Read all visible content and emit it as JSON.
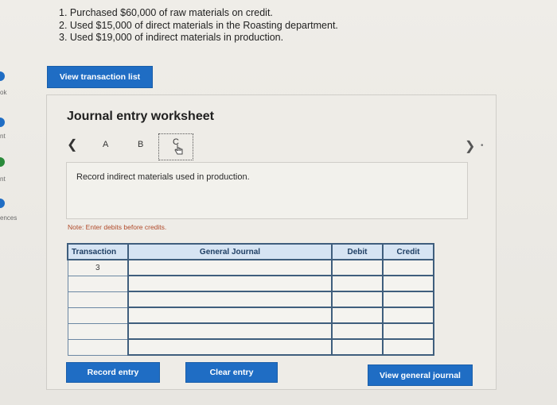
{
  "sidebar": {
    "items": [
      {
        "label": "ok"
      },
      {
        "label": "nt"
      },
      {
        "label": "nt"
      },
      {
        "label": "ences"
      }
    ]
  },
  "instructions": [
    "1. Purchased $60,000 of raw materials on credit.",
    "2. Used $15,000 of direct materials in the Roasting department.",
    "3. Used $19,000 of indirect materials in production."
  ],
  "view_transaction_list": "View transaction list",
  "worksheet": {
    "title": "Journal entry worksheet",
    "tabs": [
      "A",
      "B",
      "C"
    ],
    "description": "Record indirect materials used in production.",
    "note": "Note: Enter debits before credits.",
    "table": {
      "headers": [
        "Transaction",
        "General Journal",
        "Debit",
        "Credit"
      ],
      "transaction_number": "3",
      "row_count": 6
    },
    "buttons": {
      "record": "Record entry",
      "clear": "Clear entry",
      "view_journal": "View general journal"
    }
  },
  "colors": {
    "primary_button": "#1f6dc4",
    "table_header": "#d6e4f3",
    "note_text": "#b04a2a"
  }
}
